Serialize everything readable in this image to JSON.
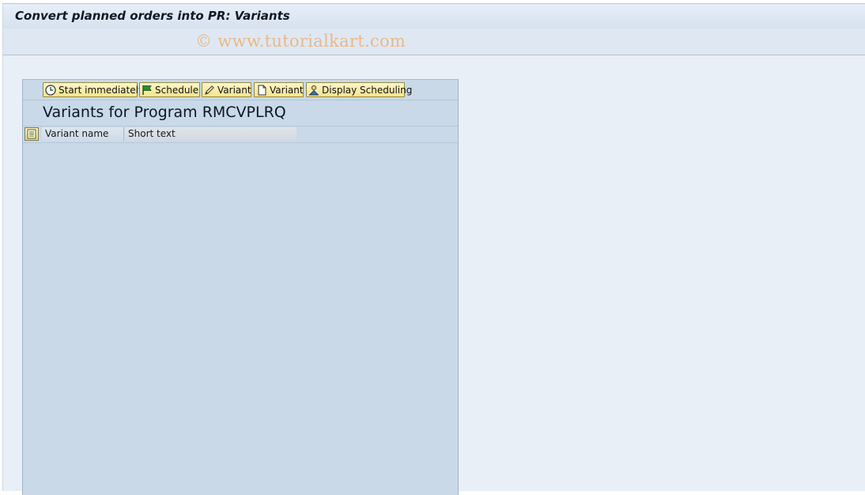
{
  "window": {
    "title": "Convert planned orders into PR: Variants",
    "watermark": "© www.tutorialkart.com"
  },
  "toolbar": {
    "buttons": [
      {
        "label": "Start immediately",
        "icon": "clock-run-icon"
      },
      {
        "label": "Schedule",
        "icon": "flag-schedule-icon"
      },
      {
        "label": "Variant",
        "icon": "pencil-edit-icon"
      },
      {
        "label": "Variant",
        "icon": "blank-page-icon"
      },
      {
        "label": "Display Scheduling",
        "icon": "person-schedule-icon"
      }
    ]
  },
  "main": {
    "heading": "Variants for Program RMCVPLRQ",
    "table": {
      "columns": [
        "Variant name",
        "Short text"
      ],
      "rows": []
    }
  },
  "colors": {
    "title_bg": "#dfe8f2",
    "panel_bg": "#c9d9e8",
    "button_bg": "#f4e58d",
    "watermark": "#e8b98a"
  }
}
